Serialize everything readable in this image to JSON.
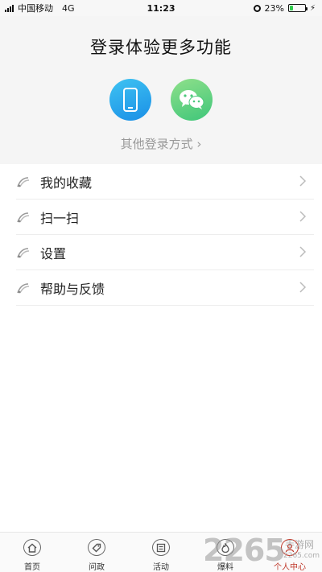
{
  "status_bar": {
    "carrier": "中国移动",
    "network": "4G",
    "time": "11:23",
    "battery": "23%",
    "battery_level": 0.23
  },
  "login": {
    "title": "登录体验更多功能",
    "phone_icon": "phone-icon",
    "wechat_icon": "wechat-icon",
    "other_methods": "其他登录方式 ›"
  },
  "menu": {
    "items": [
      {
        "label": "我的收藏",
        "icon": "bookmark-icon"
      },
      {
        "label": "扫一扫",
        "icon": "scan-icon"
      },
      {
        "label": "设置",
        "icon": "settings-icon"
      },
      {
        "label": "帮助与反馈",
        "icon": "help-icon"
      }
    ]
  },
  "tab_bar": {
    "tabs": [
      {
        "label": "首页",
        "icon": "home-icon"
      },
      {
        "label": "问政",
        "icon": "tag-icon"
      },
      {
        "label": "活动",
        "icon": "list-icon"
      },
      {
        "label": "爆料",
        "icon": "fire-icon"
      },
      {
        "label": "个人中心",
        "icon": "user-icon"
      }
    ],
    "active_index": 4
  },
  "watermark": {
    "number": "2265",
    "text": "手游网",
    "url": "2265.com"
  },
  "colors": {
    "accent_active": "#c0392b",
    "phone_button": "#1a8fe6",
    "wechat_button": "#3fc67a"
  }
}
